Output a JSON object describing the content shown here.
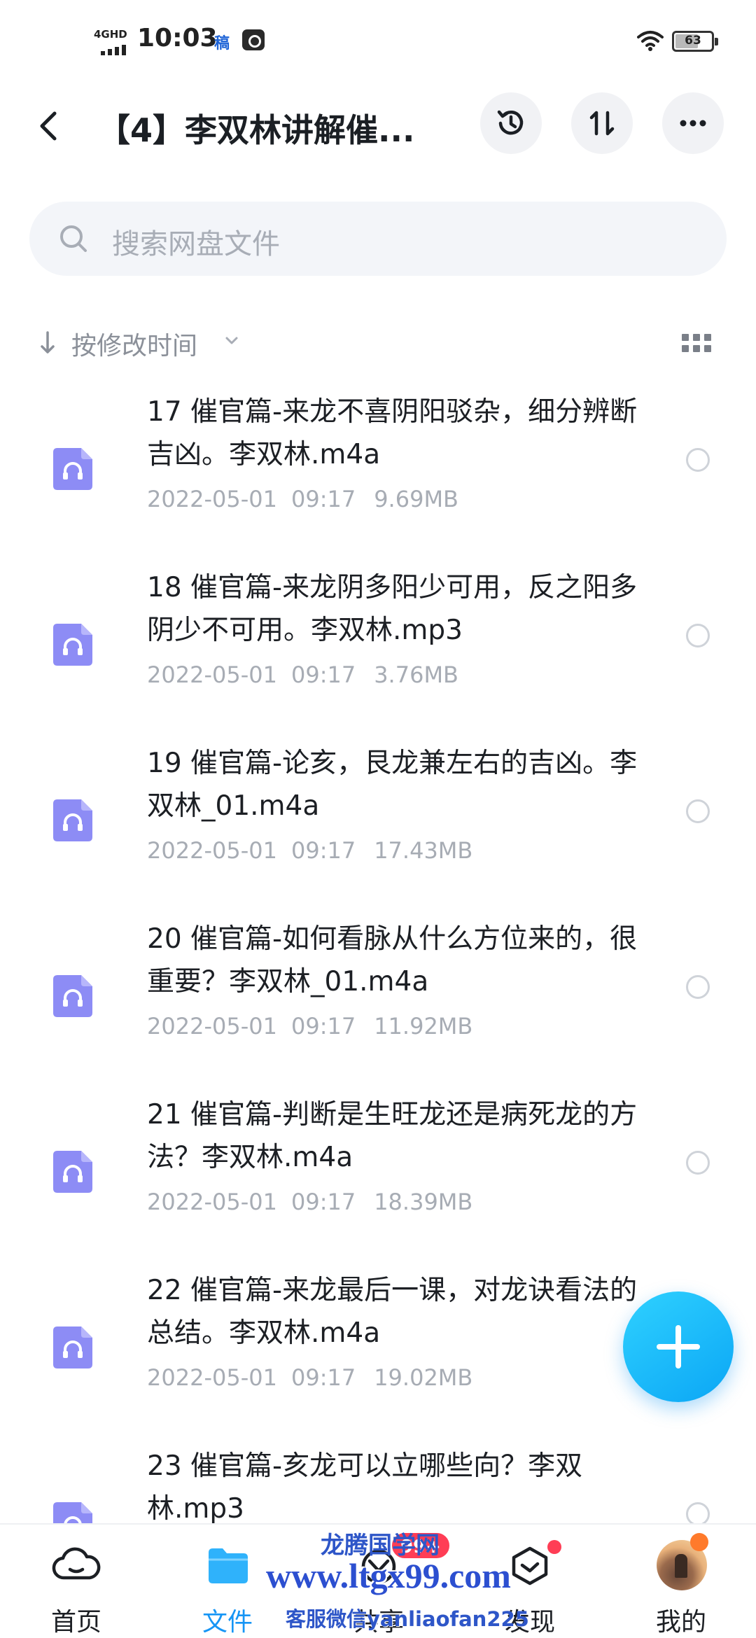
{
  "status_bar": {
    "network": "4GHD",
    "time": "10:03",
    "carrier_glyph": "稿",
    "battery": "63"
  },
  "header": {
    "title": "【4】李双林讲解催...",
    "history_icon": "history-icon",
    "sort_icon": "sort-swap-icon",
    "more_icon": "more-icon"
  },
  "search": {
    "placeholder": "搜索网盘文件"
  },
  "sort": {
    "label": "按修改时间"
  },
  "files": [
    {
      "name": "17 催官篇-来龙不喜阴阳驳杂，细分辨断吉凶。李双林.m4a",
      "date": "2022-05-01",
      "time": "09:17",
      "size": "9.69MB"
    },
    {
      "name": "18 催官篇-来龙阴多阳少可用，反之阳多阴少不可用。李双林.mp3",
      "date": "2022-05-01",
      "time": "09:17",
      "size": "3.76MB"
    },
    {
      "name": "19 催官篇-论亥，艮龙兼左右的吉凶。李双林_01.m4a",
      "date": "2022-05-01",
      "time": "09:17",
      "size": "17.43MB"
    },
    {
      "name": "20 催官篇-如何看脉从什么方位来的，很重要？李双林_01.m4a",
      "date": "2022-05-01",
      "time": "09:17",
      "size": "11.92MB"
    },
    {
      "name": "21 催官篇-判断是生旺龙还是病死龙的方法？李双林.m4a",
      "date": "2022-05-01",
      "time": "09:17",
      "size": "18.39MB"
    },
    {
      "name": "22 催官篇-来龙最后一课，对龙诀看法的总结。李双林.m4a",
      "date": "2022-05-01",
      "time": "09:17",
      "size": "19.02MB"
    },
    {
      "name": "23 催官篇-亥龙可以立哪些向？李双林.mp3",
      "date": "",
      "time": "",
      "size": ""
    }
  ],
  "bottom_nav": [
    {
      "label": "首页",
      "icon": "home-cloud-icon",
      "active": false
    },
    {
      "label": "文件",
      "icon": "folder-icon",
      "active": true
    },
    {
      "label": "共享",
      "icon": "share-icon",
      "active": false,
      "badge": "99+"
    },
    {
      "label": "发现",
      "icon": "discover-icon",
      "active": false
    },
    {
      "label": "我的",
      "icon": "avatar",
      "active": false
    }
  ],
  "watermark": {
    "line1": "龙腾国学网",
    "line2": "www.ltgx99.com",
    "line3": "客服微信yanliaofan225"
  },
  "colors": {
    "accent": "#1695f5",
    "file_icon": "#8d8cf5",
    "badge": "#ff3d55"
  }
}
